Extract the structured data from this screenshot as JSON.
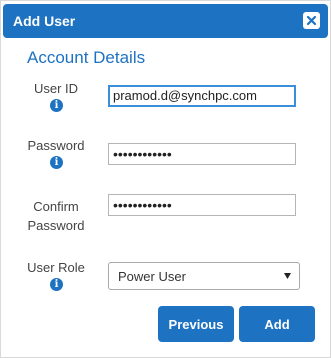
{
  "dialog": {
    "title": "Add User",
    "close_icon": "close-icon"
  },
  "section": {
    "title": "Account Details"
  },
  "form": {
    "user_id": {
      "label": "User ID",
      "value": "pramod.d@synchpc.com",
      "info_icon": "info-icon"
    },
    "password": {
      "label": "Password",
      "value": "••••••••••••",
      "info_icon": "info-icon"
    },
    "confirm_password": {
      "label_line1": "Confirm",
      "label_line2": "Password",
      "value": "••••••••••••"
    },
    "user_role": {
      "label": "User Role",
      "selected": "Power User",
      "info_icon": "info-icon",
      "caret_icon": "chevron-down-icon"
    }
  },
  "buttons": {
    "previous": "Previous",
    "add": "Add"
  },
  "colors": {
    "accent": "#1d72c1",
    "focus_border": "#3b8fd9"
  }
}
